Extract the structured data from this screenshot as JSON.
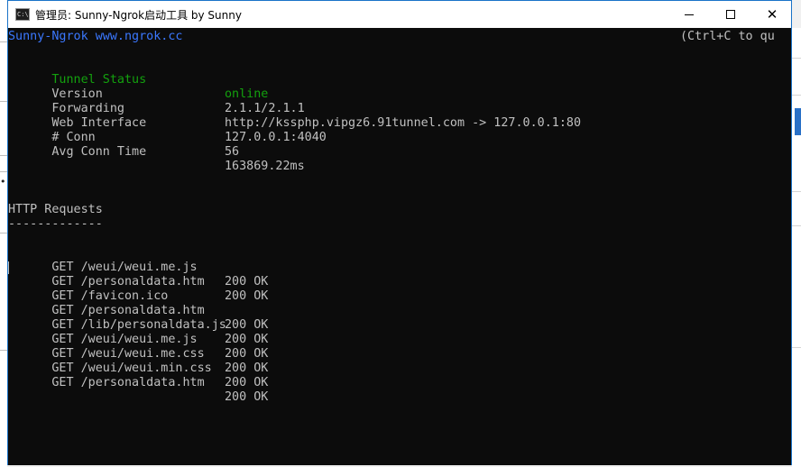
{
  "window": {
    "title": "管理员:  Sunny-Ngrok启动工具 by Sunny"
  },
  "controls": {
    "minimize": "minimize",
    "maximize": "maximize",
    "close": "✕"
  },
  "header": {
    "brand": "Sunny-Ngrok www.ngrok.cc",
    "quit_hint": "(Ctrl+C to quit)"
  },
  "status": [
    {
      "label": "Tunnel Status",
      "value": "online"
    },
    {
      "label": "Version",
      "value": "2.1.1/2.1.1"
    },
    {
      "label": "Forwarding",
      "value": "http://kssphp.vipgz6.91tunnel.com -> 127.0.0.1:80"
    },
    {
      "label": "Web Interface",
      "value": "127.0.0.1:4040"
    },
    {
      "label": "# Conn",
      "value": "56"
    },
    {
      "label": "Avg Conn Time",
      "value": "163869.22ms"
    }
  ],
  "requests_section": {
    "title": "HTTP Requests",
    "underline": "-------------"
  },
  "requests": [
    {
      "request": "GET /weui/weui.me.js",
      "status": "200 OK"
    },
    {
      "request": "GET /personaldata.htm",
      "status": "200 OK"
    },
    {
      "request": "GET /favicon.ico",
      "status": ""
    },
    {
      "request": "GET /personaldata.htm",
      "status": "200 OK"
    },
    {
      "request": "GET /lib/personaldata.js",
      "status": "200 OK"
    },
    {
      "request": "GET /weui/weui.me.js",
      "status": "200 OK"
    },
    {
      "request": "GET /weui/weui.me.css",
      "status": "200 OK"
    },
    {
      "request": "GET /weui/weui.min.css",
      "status": "200 OK"
    },
    {
      "request": "GET /personaldata.htm",
      "status": "200 OK"
    }
  ],
  "colors": {
    "console_bg": "#0c0c0c",
    "text": "#c0c0c0",
    "brand_blue": "#3b78ff",
    "online_green": "#13a10e",
    "window_border": "#1a73c8"
  }
}
